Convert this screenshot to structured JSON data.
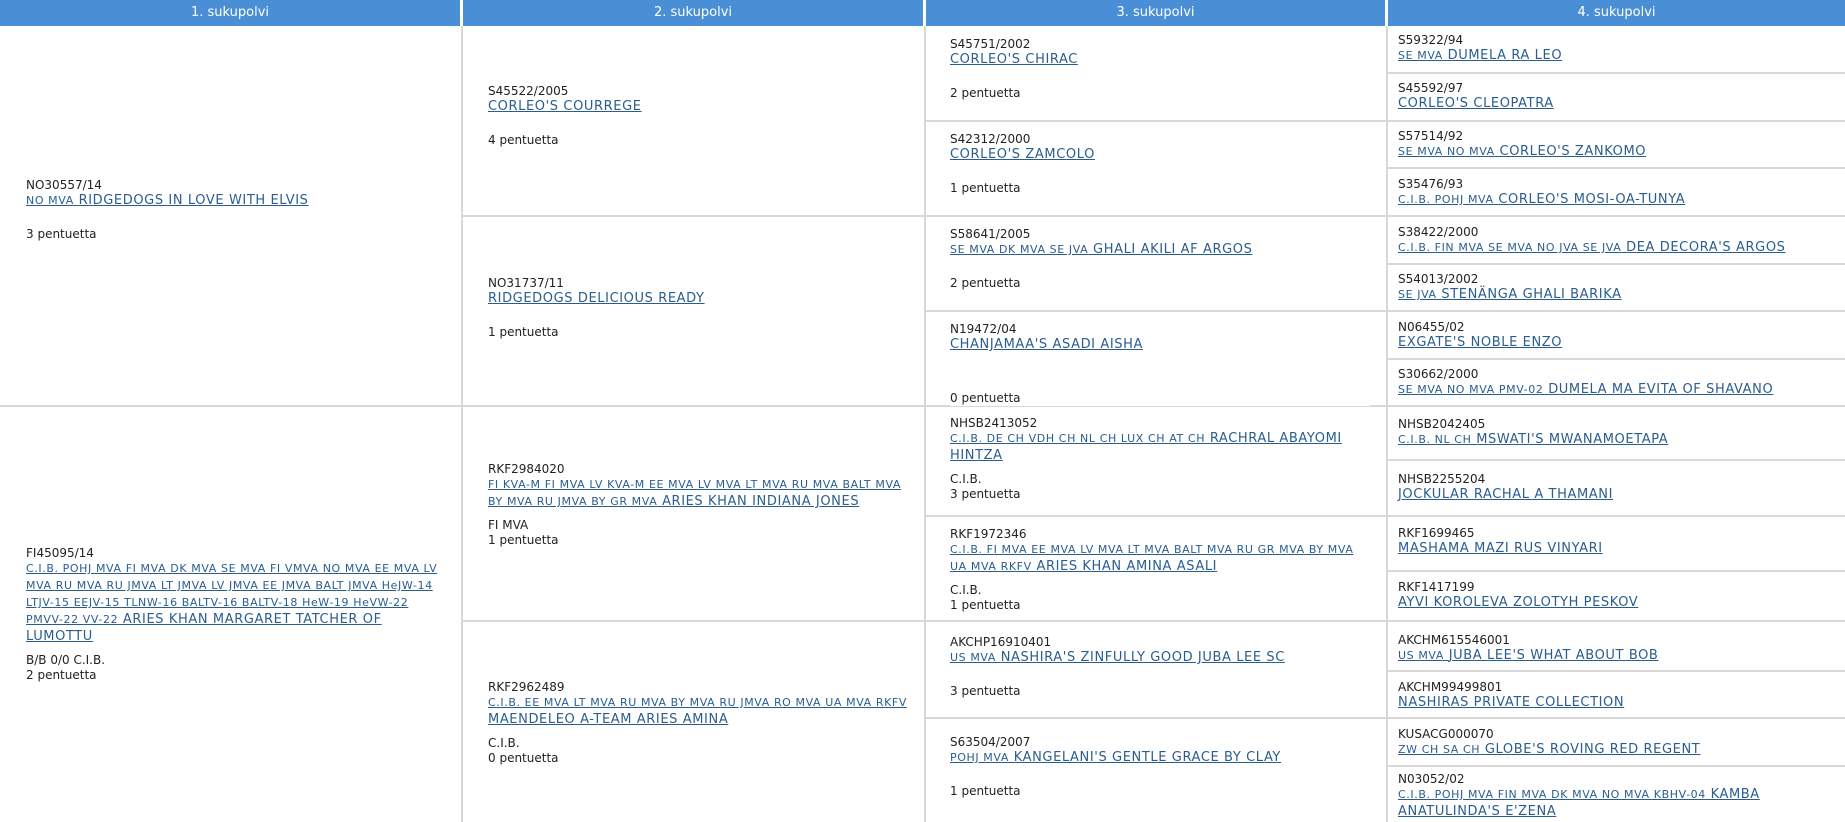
{
  "headers": [
    "1. sukupolvi",
    "2. sukupolvi",
    "3. sukupolvi",
    "4. sukupolvi"
  ],
  "gen1": [
    {
      "reg": "NO30557/14",
      "titles": "NO MVA",
      "name": "RIDGEDOGS IN LOVE WITH ELVIS",
      "extra": "",
      "litters": "3 pentuetta"
    },
    {
      "reg": "FI45095/14",
      "titles": "C.I.B. POHJ MVA FI MVA DK MVA SE MVA FI VMVA NO MVA EE MVA LV MVA RU MVA RU JMVA LT JMVA LV JMVA EE JMVA BALT JMVA HeJW-14 LTJV-15 EEJV-15 TLNW-16 BALTV-16 BALTV-18 HeW-19 HeVW-22 PMVV-22 VV-22",
      "name": "ARIES KHAN MARGARET TATCHER OF LUMOTTU",
      "extra": "B/B   0/0   C.I.B.",
      "litters": "2 pentuetta"
    }
  ],
  "gen2": [
    {
      "reg": "S45522/2005",
      "titles": "",
      "name": "CORLEO'S COURREGE",
      "extra": "",
      "litters": "4 pentuetta"
    },
    {
      "reg": "NO31737/11",
      "titles": "",
      "name": "RIDGEDOGS DELICIOUS READY",
      "extra": "",
      "litters": "1 pentuetta"
    },
    {
      "reg": "RKF2984020",
      "titles": "FI KVA-M FI MVA LV KVA-M EE MVA LV MVA LT MVA RU MVA BALT MVA BY MVA RU JMVA BY GR MVA",
      "name": "ARIES KHAN INDIANA JONES",
      "extra": "FI MVA",
      "litters": "1 pentuetta"
    },
    {
      "reg": "RKF2962489",
      "titles": "C.I.B. EE MVA LT MVA RU MVA BY MVA RU JMVA RO MVA UA MVA RKFV",
      "name": "MAENDELEO A-TEAM ARIES AMINA",
      "extra": "C.I.B.",
      "litters": "0 pentuetta"
    }
  ],
  "gen3": [
    {
      "reg": "S45751/2002",
      "titles": "",
      "name": "CORLEO'S CHIRAC",
      "extra": "",
      "litters": "2 pentuetta"
    },
    {
      "reg": "S42312/2000",
      "titles": "",
      "name": "CORLEO'S ZAMCOLO",
      "extra": "",
      "litters": "1 pentuetta"
    },
    {
      "reg": "S58641/2005",
      "titles": "SE MVA DK MVA SE JVA",
      "name": "GHALI AKILI AF ARGOS",
      "extra": "",
      "litters": "2 pentuetta"
    },
    {
      "reg": "N19472/04",
      "titles": "",
      "name": "CHANJAMAA'S ASADI AISHA",
      "extra": "",
      "litters": "0 pentuetta"
    },
    {
      "reg": "NHSB2413052",
      "titles": "C.I.B. DE CH VDH CH NL CH LUX CH AT CH",
      "name": "RACHRAL ABAYOMI HINTZA",
      "extra": "C.I.B.",
      "litters": "3 pentuetta"
    },
    {
      "reg": "RKF1972346",
      "titles": "C.I.B. FI MVA EE MVA LV MVA LT MVA BALT MVA RU GR MVA BY MVA UA MVA RKFV",
      "name": "ARIES KHAN AMINA ASALI",
      "extra": "C.I.B.",
      "litters": "1 pentuetta"
    },
    {
      "reg": "AKCHP16910401",
      "titles": "US MVA",
      "name": "NASHIRA'S ZINFULLY GOOD JUBA LEE SC",
      "extra": "",
      "litters": "3 pentuetta"
    },
    {
      "reg": "S63504/2007",
      "titles": "POHJ MVA",
      "name": "KANGELANI'S GENTLE GRACE BY CLAY",
      "extra": "",
      "litters": "1 pentuetta"
    }
  ],
  "gen4": [
    {
      "reg": "S59322/94",
      "titles": "SE MVA",
      "name": "DUMELA RA LEO"
    },
    {
      "reg": "S45592/97",
      "titles": "",
      "name": "CORLEO'S CLEOPATRA"
    },
    {
      "reg": "S57514/92",
      "titles": "SE MVA NO MVA",
      "name": "CORLEO'S ZANKOMO"
    },
    {
      "reg": "S35476/93",
      "titles": "C.I.B. POHJ MVA",
      "name": "CORLEO'S MOSI-OA-TUNYA"
    },
    {
      "reg": "S38422/2000",
      "titles": "C.I.B. FIN MVA SE MVA NO JVA SE JVA",
      "name": "DEA DECORA'S ARGOS"
    },
    {
      "reg": "S54013/2002",
      "titles": "SE JVA",
      "name": "STENÄNGA GHALI BARIKA"
    },
    {
      "reg": "N06455/02",
      "titles": "",
      "name": "EXGATE'S NOBLE ENZO"
    },
    {
      "reg": "S30662/2000",
      "titles": "SE MVA NO MVA PMV-02",
      "name": "DUMELA MA EVITA OF SHAVANO"
    },
    {
      "reg": "NHSB2042405",
      "titles": "C.I.B. NL CH",
      "name": "MSWATI'S MWANAMOETAPA"
    },
    {
      "reg": "NHSB2255204",
      "titles": "",
      "name": "JOCKULAR RACHAL A THAMANI"
    },
    {
      "reg": "RKF1699465",
      "titles": "",
      "name": "MASHAMA MAZI RUS VINYARI"
    },
    {
      "reg": "RKF1417199",
      "titles": "",
      "name": "AYVI KOROLEVA ZOLOTYH PESKOV"
    },
    {
      "reg": "AKCHM615546001",
      "titles": "US MVA",
      "name": "JUBA LEE'S WHAT ABOUT BOB"
    },
    {
      "reg": "AKCHM99499801",
      "titles": "",
      "name": "NASHIRAS PRIVATE COLLECTION"
    },
    {
      "reg": "KUSACG000070",
      "titles": "ZW CH SA CH",
      "name": "GLOBE'S ROVING RED REGENT"
    },
    {
      "reg": "N03052/02",
      "titles": "C.I.B. POHJ MVA FIN MVA DK MVA NO MVA KBHV-04",
      "name": "KAMBA ANATULINDA'S E'ZENA"
    }
  ]
}
